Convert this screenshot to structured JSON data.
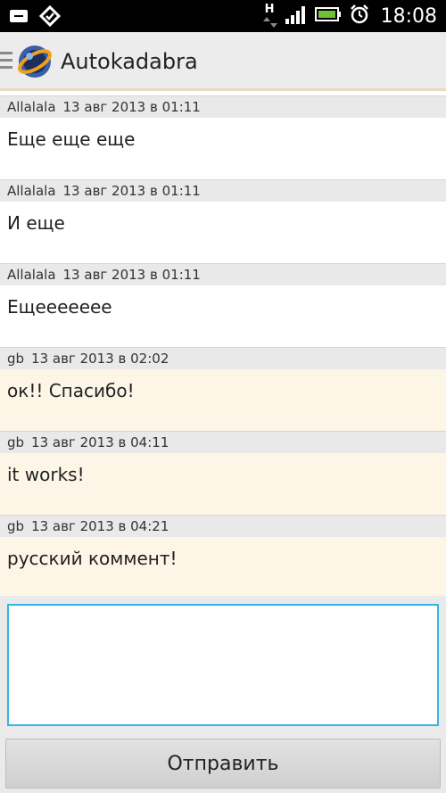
{
  "status_bar": {
    "time": "18:08",
    "network_label": "H"
  },
  "action_bar": {
    "title": "Autokadabra"
  },
  "comments": [
    {
      "author": "Allalala",
      "date": "13 авг 2013 в 01:11",
      "text": "Еще еще еще",
      "own": false
    },
    {
      "author": "Allalala",
      "date": "13 авг 2013 в 01:11",
      "text": "И еще",
      "own": false
    },
    {
      "author": "Allalala",
      "date": "13 авг 2013 в 01:11",
      "text": "Ещеееееее",
      "own": false
    },
    {
      "author": "gb",
      "date": "13 авг 2013 в 02:02",
      "text": "ок!! Спасибо!",
      "own": true
    },
    {
      "author": "gb",
      "date": "13 авг 2013 в 04:11",
      "text": "it works!",
      "own": true
    },
    {
      "author": "gb",
      "date": "13 авг 2013 в 04:21",
      "text": "русский коммент!",
      "own": true
    }
  ],
  "composer": {
    "input_value": "",
    "send_label": "Отправить"
  },
  "colors": {
    "accent": "#33b5e5",
    "own_comment_bg": "#fdf6e7",
    "header_bg": "#e9e9e9"
  }
}
